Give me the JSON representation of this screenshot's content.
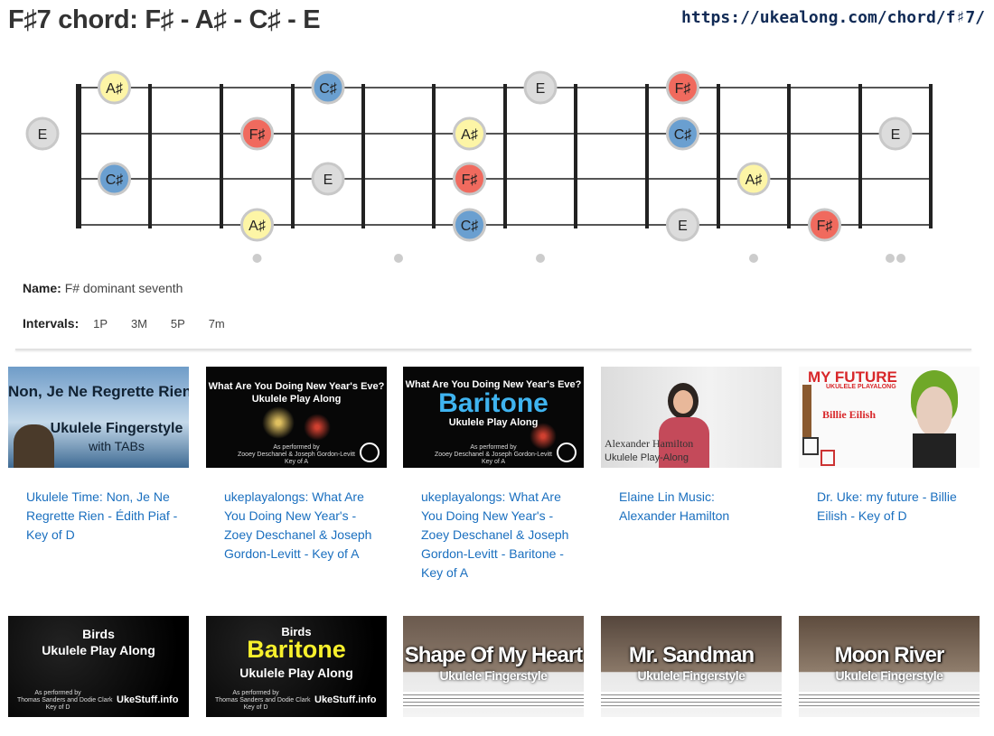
{
  "title": "F♯7 chord: F♯ - A♯ - C♯ - E",
  "url": "https://ukealong.com/chord/f♯7/",
  "notes": {
    "A#": "A♯",
    "C#": "C♯",
    "E": "E",
    "F#": "F♯"
  },
  "note_colors": {
    "A#": "#fdf5a6",
    "C#": "#6a9fd0",
    "E": "#dcdcdc",
    "F#": "#f06a5e"
  },
  "fretboard_positions": [
    {
      "string": 1,
      "fret": 0,
      "note": "E"
    },
    {
      "string": 1,
      "fret": 3,
      "note": "F#"
    },
    {
      "string": 1,
      "fret": 6,
      "note": "A#"
    },
    {
      "string": 1,
      "fret": 9,
      "note": "C#"
    },
    {
      "string": 1,
      "fret": 12,
      "note": "E"
    },
    {
      "string": 0,
      "fret": 1,
      "note": "A#"
    },
    {
      "string": 0,
      "fret": 4,
      "note": "C#"
    },
    {
      "string": 0,
      "fret": 7,
      "note": "E"
    },
    {
      "string": 0,
      "fret": 9,
      "note": "F#"
    },
    {
      "string": 2,
      "fret": 1,
      "note": "C#"
    },
    {
      "string": 2,
      "fret": 4,
      "note": "E"
    },
    {
      "string": 2,
      "fret": 6,
      "note": "F#"
    },
    {
      "string": 2,
      "fret": 10,
      "note": "A#"
    },
    {
      "string": 3,
      "fret": 3,
      "note": "A#"
    },
    {
      "string": 3,
      "fret": 6,
      "note": "C#"
    },
    {
      "string": 3,
      "fret": 9,
      "note": "E"
    },
    {
      "string": 3,
      "fret": 11,
      "note": "F#"
    }
  ],
  "fret_markers": [
    3,
    5,
    7,
    10,
    12
  ],
  "name_label": "Name:",
  "name_value": "F# dominant seventh",
  "intervals_label": "Intervals:",
  "intervals": [
    "1P",
    "3M",
    "5P",
    "7m"
  ],
  "videos": [
    {
      "caption": "Ukulele Time: Non, Je Ne Regrette Rien - Édith Piaf - Key of D",
      "thumb": {
        "line1": "Non, Je Ne Regrette Rien",
        "line2": "Ukulele Fingerstyle",
        "line3": "with TABs"
      }
    },
    {
      "caption": "ukeplayalongs: What Are You Doing New Year's - Zoey Deschanel & Joseph Gordon-Levitt - Key of A",
      "thumb": {
        "line1": "What Are You Doing New Year's Eve?",
        "line2": "Ukulele Play Along",
        "small1": "As performed by",
        "small2": "Zooey Deschanel & Joseph Gordon-Levitt",
        "small3": "Key of A"
      }
    },
    {
      "caption": "ukeplayalongs: What Are You Doing New Year's - Zoey Deschanel & Joseph Gordon-Levitt - Baritone - Key of A",
      "thumb": {
        "line1": "What Are You Doing New Year's Eve?",
        "big": "Baritone",
        "line2": "Ukulele Play Along",
        "small1": "As performed by",
        "small2": "Zooey Deschanel & Joseph Gordon-Levitt",
        "small3": "Key of A"
      }
    },
    {
      "caption": "Elaine Lin Music: Alexander Hamilton",
      "thumb": {
        "line1": "Alexander Hamilton",
        "line2": "Ukulele Play-Along"
      }
    },
    {
      "caption": "Dr. Uke: my future - Billie Eilish - Key of D",
      "thumb": {
        "line1": "MY FUTURE",
        "line2": "UKULELE PLAYALONG",
        "line3": "Billie Eilish"
      }
    },
    {
      "caption": "",
      "thumb": {
        "line1": "Birds",
        "line2": "Ukulele Play Along",
        "small1": "As performed by",
        "small2": "Thomas Sanders and Dodie Clark",
        "small3": "Key of D",
        "brand": "UkeStuff.info"
      }
    },
    {
      "caption": "",
      "thumb": {
        "line1": "Birds",
        "big": "Baritone",
        "line2": "Ukulele Play Along",
        "small1": "As performed by",
        "small2": "Thomas Sanders and Dodie Clark",
        "small3": "Key of D",
        "brand": "UkeStuff.info"
      }
    },
    {
      "caption": "",
      "thumb": {
        "line1": "Shape Of My Heart",
        "line2": "Ukulele Fingerstyle"
      }
    },
    {
      "caption": "",
      "thumb": {
        "line1": "Mr. Sandman",
        "line2": "Ukulele Fingerstyle"
      }
    },
    {
      "caption": "",
      "thumb": {
        "line1": "Moon River",
        "line2": "Ukulele Fingerstyle"
      }
    }
  ]
}
